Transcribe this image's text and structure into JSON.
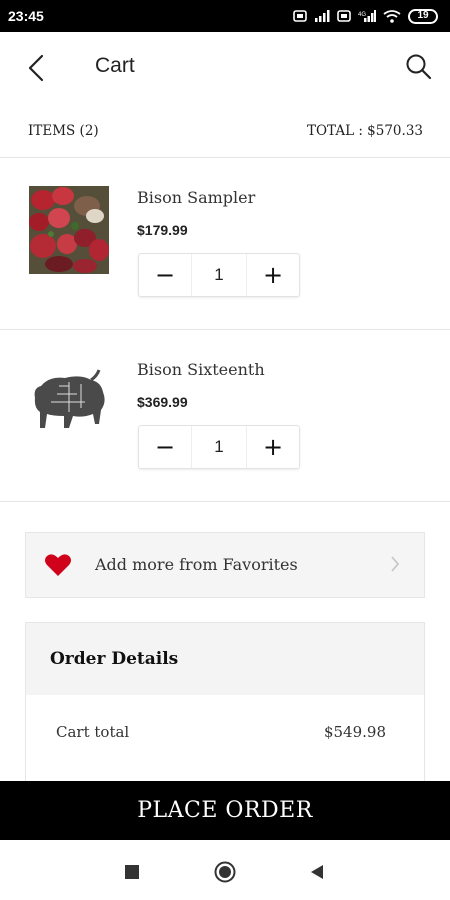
{
  "status_bar": {
    "time": "23:45",
    "battery": "19"
  },
  "app_bar": {
    "title": "Cart"
  },
  "summary": {
    "items_label": "ITEMS (2)",
    "total_label": "TOTAL : $570.33"
  },
  "cart": {
    "items": [
      {
        "name": "Bison Sampler",
        "price": "$179.99",
        "quantity": "1"
      },
      {
        "name": "Bison Sixteenth",
        "price": "$369.99",
        "quantity": "1"
      }
    ]
  },
  "stepper": {
    "minus": "−",
    "plus": "+"
  },
  "favorites": {
    "label": "Add more from Favorites",
    "icon": "heart-icon",
    "icon_color": "#d0021b"
  },
  "order_details": {
    "title": "Order Details",
    "rows": [
      {
        "label": "Cart total",
        "value": "$549.98"
      }
    ]
  },
  "footer": {
    "place_order": "PLACE ORDER"
  },
  "colors": {
    "primary_button": "#000000",
    "accent": "#d0021b"
  }
}
